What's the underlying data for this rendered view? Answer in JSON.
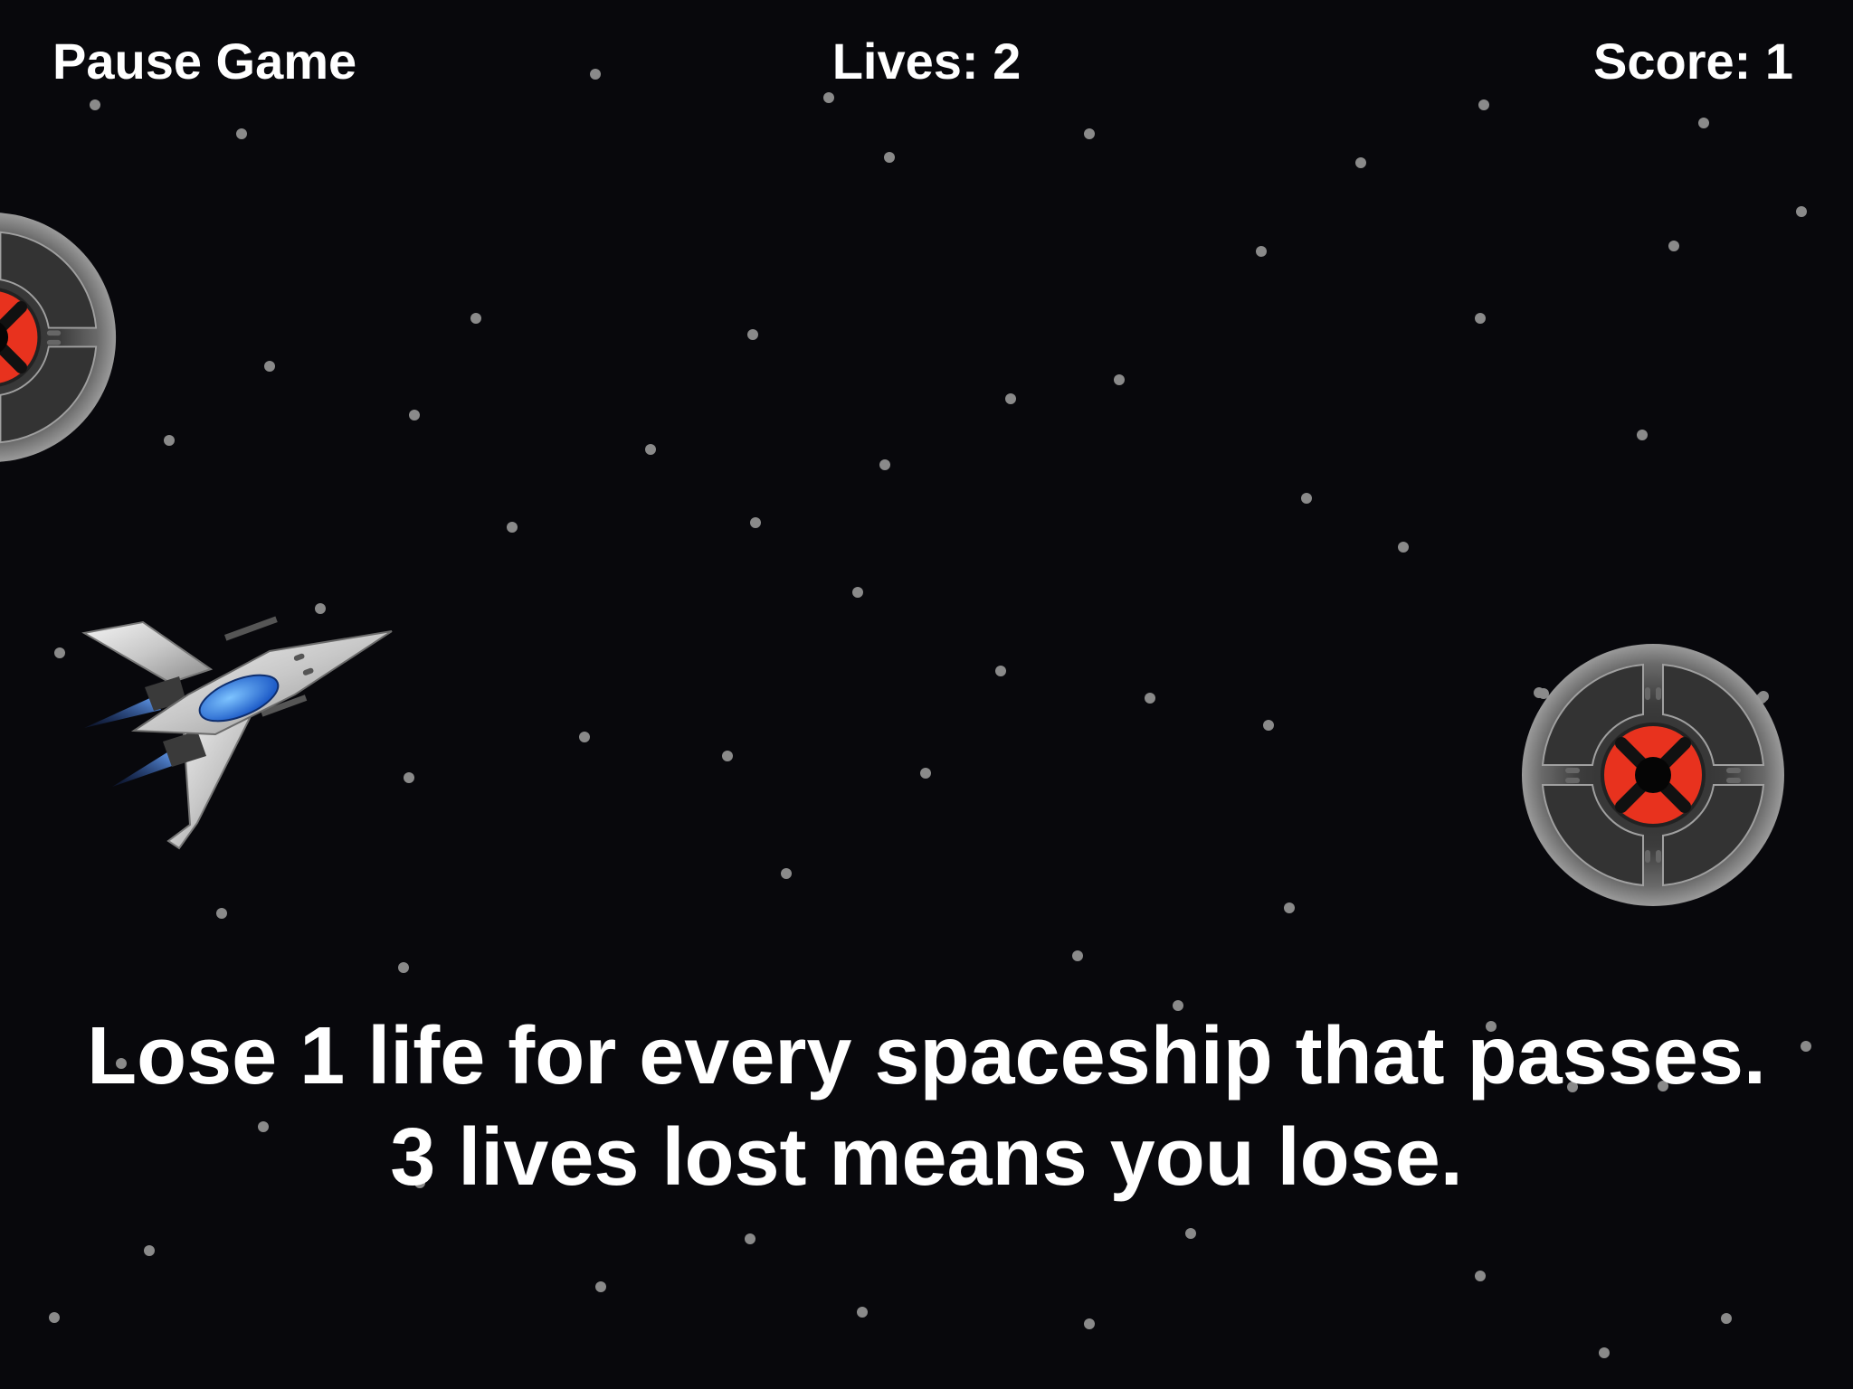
{
  "hud": {
    "pause_label": "Pause Game",
    "lives_label": "Lives: 2",
    "score_label": "Score: 1"
  },
  "game": {
    "lives": 2,
    "score": 1
  },
  "instructions": {
    "line1": "Lose 1 life for every spaceship that passes.",
    "line2": "3 lives lost means you lose."
  },
  "colors": {
    "background": "#08080c",
    "star": "#8a8a8a",
    "hud_text": "#ffffff",
    "enemy_core": "#e8321e",
    "player_cockpit": "#3a8ee8",
    "player_thruster": "#4a86e8"
  },
  "sprites": {
    "player": "player-spaceship-icon",
    "enemy": "enemy-saucer-icon"
  }
}
